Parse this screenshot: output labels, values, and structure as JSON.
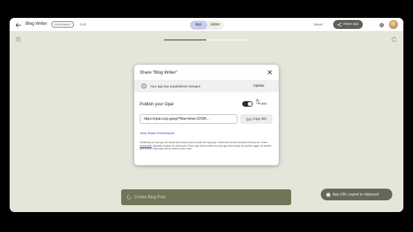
{
  "header": {
    "title": "Blog Writer",
    "badge": "EXPERIMENT",
    "draft": "Draft",
    "tabs": [
      {
        "label": "App",
        "active": true
      },
      {
        "label": "Editor",
        "active": false
      }
    ],
    "saved": "Saved",
    "share_label": "Share app"
  },
  "toolbar": {
    "progress": 0.5
  },
  "dialog": {
    "title": "Share “Blog Writer”",
    "banner_text": "Your app has unpublished changes",
    "update_label": "Update",
    "publish_label": "Publish your Opal",
    "toggle_on": true,
    "public_label": "Public",
    "url": "https://opal.corp.goog/?flow=drive:/1FDR...",
    "copy_label": "Copy link",
    "permissions_label": "View Share Permissions",
    "desc_part1": "Publishing an Opal app will reveal all prompts used to create the Opal app. Public links can be reshared with anyone. Share ",
    "desc_link": "responsibly",
    "desc_part2": ", unpublish anytime by clicking the 'Share app' button within this Opal app and change the publish toggle. All created and remixed Opal apps will be saved in your Drive."
  },
  "create_button": "Create Blog Post",
  "toast": "App URL copied to clipboard",
  "colors": {
    "accent": "#3d41b8",
    "tab_active": "#c9cdef",
    "canvas": "#e3e6d9",
    "create_bg": "#6f7658"
  }
}
